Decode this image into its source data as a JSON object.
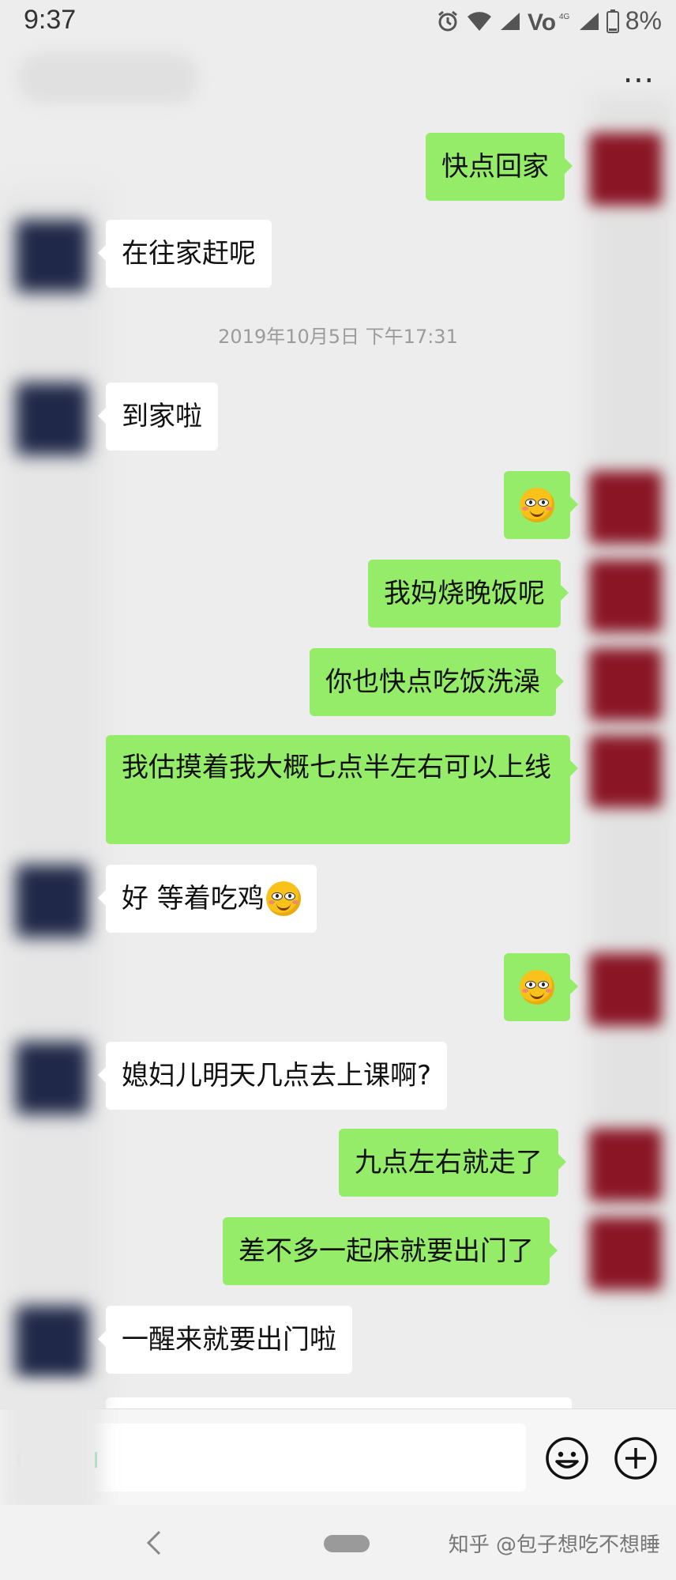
{
  "status_bar": {
    "time": "9:37",
    "battery": "8%"
  },
  "header": {
    "more_label": "⋯"
  },
  "timestamp": "2019年10月5日 下午17:31",
  "messages": [
    {
      "text": "快点回家"
    },
    {
      "text": "在往家赶呢"
    },
    {
      "text": "到家啦"
    },
    {
      "text": "",
      "emoji": "smirk-face-emoji"
    },
    {
      "text": "我妈烧晚饭呢"
    },
    {
      "text": "你也快点吃饭洗澡"
    },
    {
      "text": "我估摸着我大概七点半左右可以上线"
    },
    {
      "text": "好  等着吃鸡",
      "emoji": "smirk-face-emoji"
    },
    {
      "text": "",
      "emoji": "smirk-face-emoji"
    },
    {
      "text": "媳妇儿明天几点去上课啊?"
    },
    {
      "text": "九点左右就走了"
    },
    {
      "text": "差不多一起床就要出门了"
    },
    {
      "text": "一醒来就要出门啦"
    }
  ],
  "watermark": "知乎 @包子想吃不想睡",
  "colors": {
    "background": "#ededed",
    "outgoing_bubble": "#95ec69",
    "incoming_bubble": "#ffffff",
    "timestamp_text": "#9b9b9b"
  }
}
